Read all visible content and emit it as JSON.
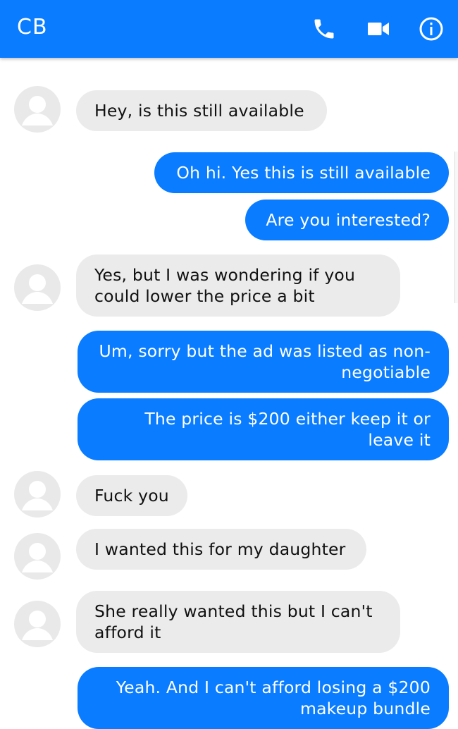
{
  "header": {
    "title": "CB",
    "icons": [
      "phone-icon",
      "video-icon",
      "info-icon"
    ],
    "color": "#0a7cff"
  },
  "messages": [
    {
      "from": "them",
      "text": "Hey, is this still available"
    },
    {
      "from": "me",
      "text": "Oh hi. Yes this is still available"
    },
    {
      "from": "me",
      "text": "Are you interested?"
    },
    {
      "from": "them",
      "text": "Yes, but I was wondering if you could lower the price a bit"
    },
    {
      "from": "me",
      "text": "Um, sorry but the ad was listed as non-negotiable"
    },
    {
      "from": "me",
      "text": "The price is $200 either keep it or leave it"
    },
    {
      "from": "them",
      "text": "Fuck you"
    },
    {
      "from": "them",
      "text": "I wanted this for my daughter"
    },
    {
      "from": "them",
      "text": "She really wanted this but I can't afford it"
    },
    {
      "from": "me",
      "text": "Yeah. And I can't afford losing a $200 makeup bundle"
    }
  ],
  "colors": {
    "outgoing": "#0a7cff",
    "incoming": "#ebebeb",
    "avatar": "#e9e9e9"
  }
}
